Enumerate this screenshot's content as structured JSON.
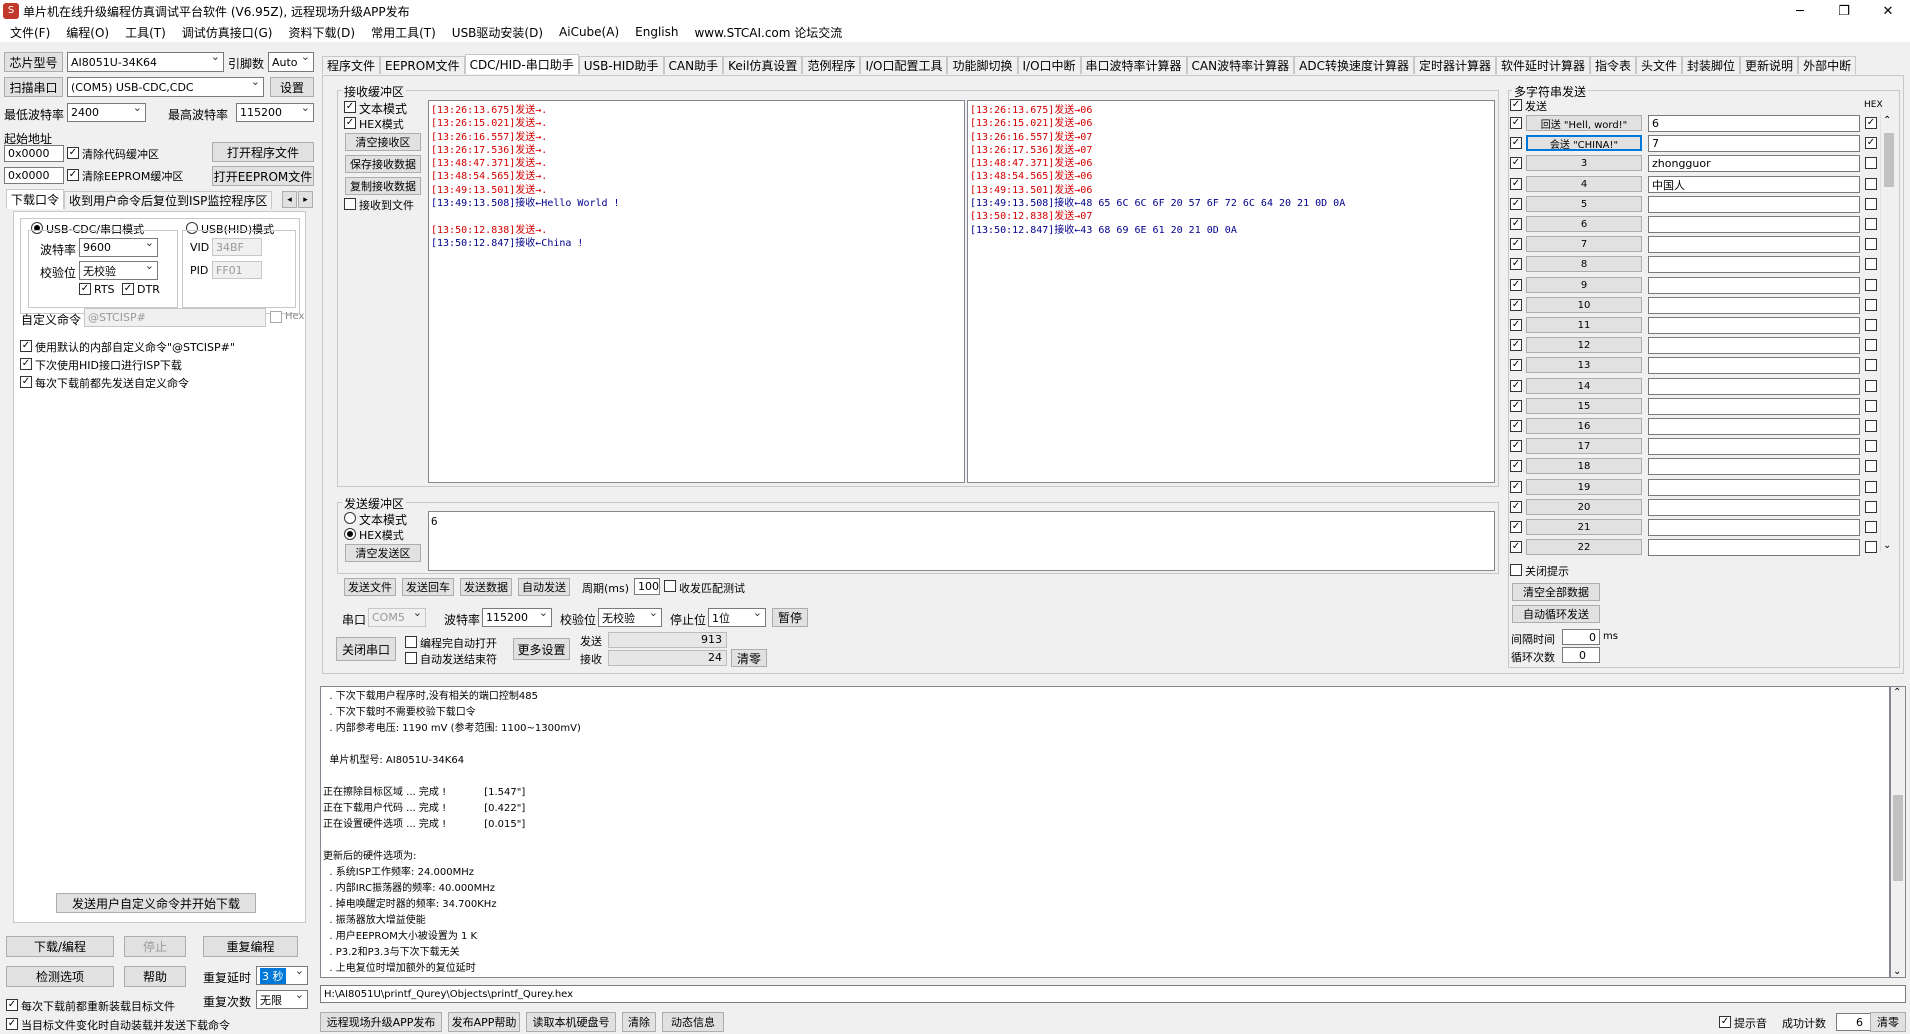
{
  "window": {
    "title": "单片机在线升级编程仿真调试平台软件 (V6.95Z), 远程现场升级APP发布",
    "btn_min": "─",
    "btn_max": "❐",
    "btn_close": "✕"
  },
  "menu": [
    "文件(F)",
    "编程(O)",
    "工具(T)",
    "调试仿真接口(G)",
    "资料下载(D)",
    "常用工具(T)",
    "USB驱动安装(D)",
    "AiCube(A)",
    "English",
    "www.STCAI.com 论坛交流"
  ],
  "left": {
    "chip_label": "芯片型号",
    "chip_value": "AI8051U-34K64",
    "pin_label": "引脚数",
    "pin_value": "Auto",
    "scan_btn": "扫描串口",
    "port_value": "(COM5) USB-CDC,CDC",
    "settings_btn": "设置",
    "min_baud_label": "最低波特率",
    "min_baud": "2400",
    "max_baud_label": "最高波特率",
    "max_baud": "115200",
    "start_addr_label": "起始地址",
    "addr1": "0x0000",
    "clear_code_label": "清除代码缓冲区",
    "open_prog_btn": "打开程序文件",
    "addr2": "0x0000",
    "clear_eeprom_label": "清除EEPROM缓冲区",
    "open_eeprom_btn": "打开EEPROM文件",
    "tab_download": "下载口令",
    "tab_reset": "收到用户命令后复位到ISP监控程序区",
    "usb_cdc_mode": "USB-CDC/串口模式",
    "usb_hid_mode": "USB(HID)模式",
    "baud_label": "波特率",
    "baud_value": "9600",
    "parity_label": "校验位",
    "parity_value": "无校验",
    "vid_label": "VID",
    "vid_value": "34BF",
    "pid_label": "PID",
    "pid_value": "FF01",
    "rts": "RTS",
    "dtr": "DTR",
    "custom_cmd_label": "自定义命令",
    "custom_cmd_value": "@STCISP#",
    "hex": "Hex",
    "opt1": "使用默认的内部自定义命令\"@STCISP#\"",
    "opt2": "下次使用HID接口进行ISP下载",
    "opt3": "每次下载前都先发送自定义命令",
    "send_custom_btn": "发送用户自定义命令并开始下载",
    "download_btn": "下载/编程",
    "stop_btn": "停止",
    "reprogram_btn": "重复编程",
    "check_btn": "检测选项",
    "help_btn": "帮助",
    "retry_delay_label": "重复延时",
    "retry_delay": "3 秒",
    "reload_label": "每次下载前都重新装载目标文件",
    "retry_count_label": "重复次数",
    "retry_count": "无限",
    "auto_load_label": "当目标文件变化时自动装载并发送下载命令"
  },
  "tabs": [
    "程序文件",
    "EEPROM文件",
    "CDC/HID-串口助手",
    "USB-HID助手",
    "CAN助手",
    "Keil仿真设置",
    "范例程序",
    "I/O口配置工具",
    "功能脚切换",
    "I/O口中断",
    "串口波特率计算器",
    "CAN波特率计算器",
    "ADC转换速度计算器",
    "定时器计算器",
    "软件延时计算器",
    "指令表",
    "头文件",
    "封装脚位",
    "更新说明",
    "外部中断"
  ],
  "recv": {
    "group_label": "接收缓冲区",
    "text_mode": "文本模式",
    "hex_mode": "HEX模式",
    "clear_btn": "清空接收区",
    "save_btn": "保存接收数据",
    "copy_btn": "复制接收数据",
    "to_file": "接收到文件",
    "text_lines": [
      {
        "t": "send",
        "s": "[13:26:13.675]发送→."
      },
      {
        "t": "send",
        "s": "[13:26:15.021]发送→."
      },
      {
        "t": "send",
        "s": "[13:26:16.557]发送→."
      },
      {
        "t": "send",
        "s": "[13:26:17.536]发送→."
      },
      {
        "t": "send",
        "s": "[13:48:47.371]发送→."
      },
      {
        "t": "send",
        "s": "[13:48:54.565]发送→."
      },
      {
        "t": "send",
        "s": "[13:49:13.501]发送→."
      },
      {
        "t": "recv",
        "s": "[13:49:13.508]接收←Hello World !"
      },
      {
        "t": "blank",
        "s": " "
      },
      {
        "t": "send",
        "s": "[13:50:12.838]发送→."
      },
      {
        "t": "recv",
        "s": "[13:50:12.847]接收←China !"
      }
    ],
    "hex_lines": [
      {
        "t": "send",
        "s": "[13:26:13.675]发送→06"
      },
      {
        "t": "send",
        "s": "[13:26:15.021]发送→06"
      },
      {
        "t": "send",
        "s": "[13:26:16.557]发送→07"
      },
      {
        "t": "send",
        "s": "[13:26:17.536]发送→07"
      },
      {
        "t": "send",
        "s": "[13:48:47.371]发送→06"
      },
      {
        "t": "send",
        "s": "[13:48:54.565]发送→06"
      },
      {
        "t": "send",
        "s": "[13:49:13.501]发送→06"
      },
      {
        "t": "recv",
        "s": "[13:49:13.508]接收←48 65 6C 6C 6F 20 57 6F 72 6C 64 20 21 0D 0A"
      },
      {
        "t": "send",
        "s": "[13:50:12.838]发送→07"
      },
      {
        "t": "recv",
        "s": "[13:50:12.847]接收←43 68 69 6E 61 20 21 0D 0A"
      }
    ]
  },
  "sendbuf": {
    "group_label": "发送缓冲区",
    "text_mode": "文本模式",
    "hex_mode": "HEX模式",
    "clear_btn": "清空发送区",
    "content": "6",
    "send_file": "发送文件",
    "send_enter": "发送回车",
    "send_data": "发送数据",
    "auto_send": "自动发送",
    "period_label": "周期(ms)",
    "period": "100",
    "match_label": "收发匹配测试"
  },
  "serial": {
    "port_label": "串口",
    "port": "COM5",
    "baud_label": "波特率",
    "baud": "115200",
    "parity_label": "校验位",
    "parity": "无校验",
    "stop_label": "停止位",
    "stop": "1位",
    "pause_btn": "暂停",
    "close_btn": "关闭串口",
    "auto_open": "编程完自动打开",
    "auto_end": "自动发送结束符",
    "more_btn": "更多设置",
    "sent_label": "发送",
    "sent": "913",
    "recv_label": "接收",
    "recv": "24",
    "clear_btn": "清零"
  },
  "multi": {
    "group_label": "多字符串发送",
    "send_col": "发送",
    "hex_col": "HEX",
    "rows": [
      {
        "n": "回送 \"Hell, word!\"",
        "v": "6",
        "hex": true,
        "active": false
      },
      {
        "n": "会送 \"CHINA!\"",
        "v": "7",
        "hex": true,
        "active": true
      },
      {
        "n": "3",
        "v": "zhongguor",
        "hex": false,
        "active": false
      },
      {
        "n": "4",
        "v": "中国人",
        "hex": false,
        "active": false
      },
      {
        "n": "5",
        "v": "",
        "hex": false,
        "active": false
      },
      {
        "n": "6",
        "v": "",
        "hex": false,
        "active": false
      },
      {
        "n": "7",
        "v": "",
        "hex": false,
        "active": false
      },
      {
        "n": "8",
        "v": "",
        "hex": false,
        "active": false
      },
      {
        "n": "9",
        "v": "",
        "hex": false,
        "active": false
      },
      {
        "n": "10",
        "v": "",
        "hex": false,
        "active": false
      },
      {
        "n": "11",
        "v": "",
        "hex": false,
        "active": false
      },
      {
        "n": "12",
        "v": "",
        "hex": false,
        "active": false
      },
      {
        "n": "13",
        "v": "",
        "hex": false,
        "active": false
      },
      {
        "n": "14",
        "v": "",
        "hex": false,
        "active": false
      },
      {
        "n": "15",
        "v": "",
        "hex": false,
        "active": false
      },
      {
        "n": "16",
        "v": "",
        "hex": false,
        "active": false
      },
      {
        "n": "17",
        "v": "",
        "hex": false,
        "active": false
      },
      {
        "n": "18",
        "v": "",
        "hex": false,
        "active": false
      },
      {
        "n": "19",
        "v": "",
        "hex": false,
        "active": false
      },
      {
        "n": "20",
        "v": "",
        "hex": false,
        "active": false
      },
      {
        "n": "21",
        "v": "",
        "hex": false,
        "active": false
      },
      {
        "n": "22",
        "v": "",
        "hex": false,
        "active": false
      }
    ],
    "close_hint": "关闭提示",
    "clear_all_btn": "清空全部数据",
    "auto_loop_btn": "自动循环发送",
    "interval_label": "间隔时间",
    "interval": "0",
    "interval_unit": "ms",
    "loop_label": "循环次数",
    "loop": "0"
  },
  "output": [
    "  . 下次下载用户程序时,没有相关的端口控制485",
    "  . 下次下载时不需要校验下载口令",
    "  . 内部参考电压: 1190 mV (参考范围: 1100~1300mV)",
    " ",
    "  单片机型号: AI8051U-34K64",
    " ",
    "正在擦除目标区域 ... 完成 !            [1.547\"]",
    "正在下载用户代码 ... 完成 !            [0.422\"]",
    "正在设置硬件选项 ... 完成 !            [0.015\"]",
    " ",
    "更新后的硬件选项为:",
    "  . 系统ISP工作频率: 24.000MHz",
    "  . 内部IRC振荡器的频率: 40.000MHz",
    "  . 掉电唤醒定时器的频率: 34.700KHz",
    "  . 振荡器放大增益使能",
    "  . 用户EEPROM大小被设置为 1 K",
    "  . P3.2和P3.3与下次下载无关",
    "  . 上电复位时增加额外的复位延时"
  ],
  "filepath": "H:\\AI8051U\\printf_Qurey\\Objects\\printf_Qurey.hex",
  "status": {
    "btn1": "远程现场升级APP发布",
    "btn2": "发布APP帮助",
    "btn3": "读取本机硬盘号",
    "btn4": "清除",
    "btn5": "动态信息",
    "hint": "提示音",
    "count_label": "成功计数",
    "count": "6",
    "clear": "清零"
  }
}
